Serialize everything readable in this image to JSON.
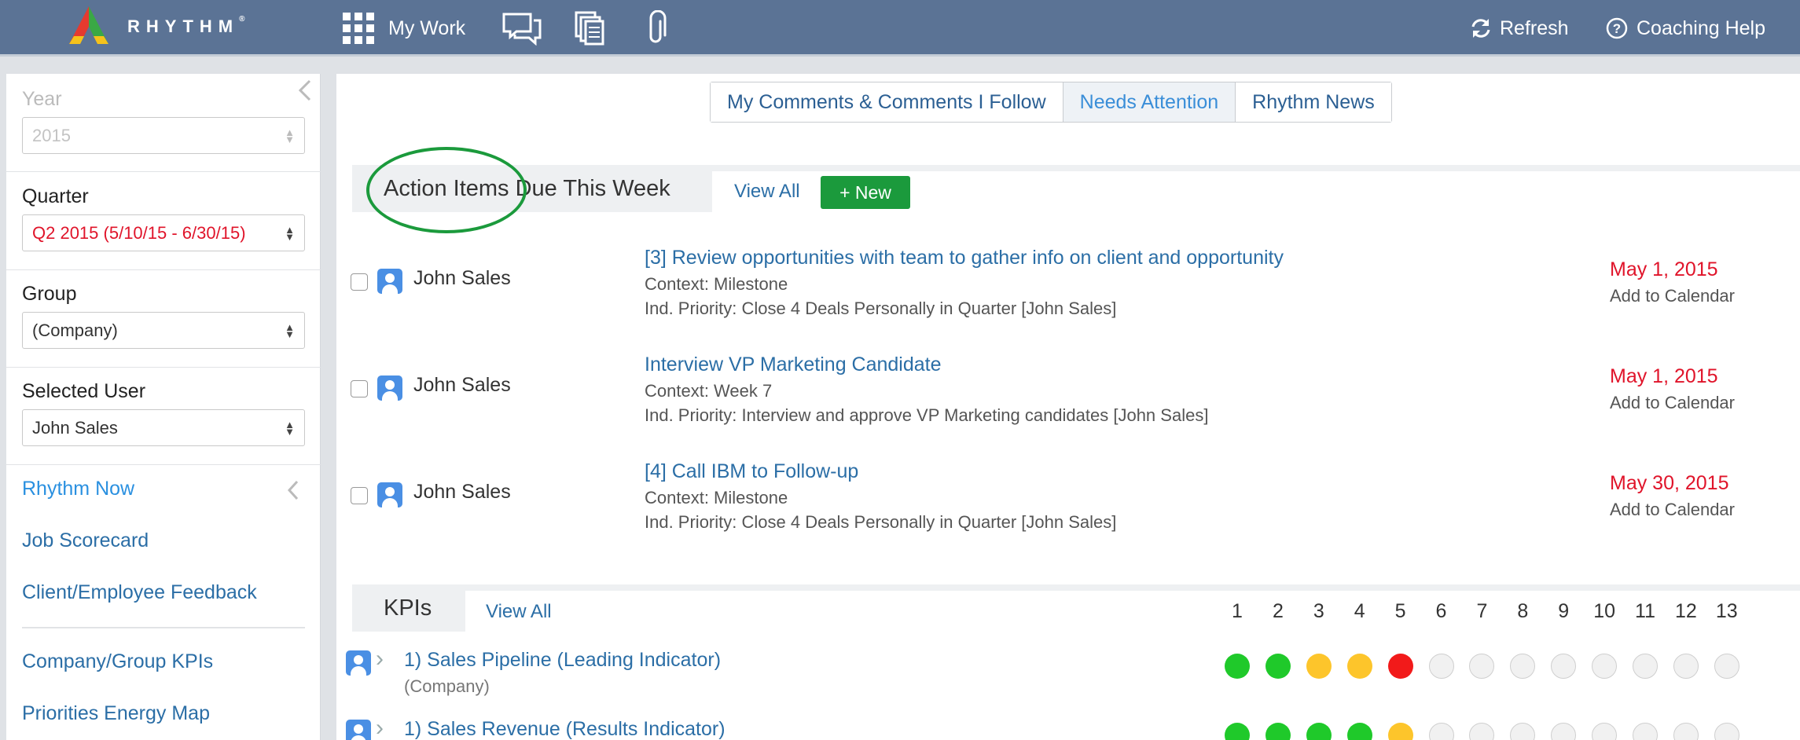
{
  "header": {
    "brand": "RHYTHM",
    "brand_mark": "®",
    "my_work": "My Work",
    "refresh": "Refresh",
    "coaching_help": "Coaching Help"
  },
  "sidebar": {
    "year_label": "Year",
    "year_value": "2015",
    "quarter_label": "Quarter",
    "quarter_value": "Q2 2015 (5/10/15 - 6/30/15)",
    "group_label": "Group",
    "group_value": "(Company)",
    "user_label": "Selected User",
    "user_value": "John Sales",
    "links": [
      "Rhythm Now",
      "Job Scorecard",
      "Client/Employee Feedback",
      "Company/Group KPIs",
      "Priorities Energy Map"
    ]
  },
  "tabs": [
    "My Comments & Comments I Follow",
    "Needs Attention",
    "Rhythm News"
  ],
  "action_items": {
    "title": "Action Items Due This Week",
    "view_all": "View All",
    "new_label": "+ New",
    "items": [
      {
        "owner": "John Sales",
        "title": "[3] Review opportunities with team to gather info on client and opportunity",
        "context": "Context: Milestone",
        "priority": "Ind. Priority: Close 4 Deals Personally in Quarter [John Sales]",
        "date": "May 1, 2015",
        "calendar": "Add to Calendar"
      },
      {
        "owner": "John Sales",
        "title": "Interview VP Marketing Candidate",
        "context": "Context: Week 7",
        "priority": "Ind. Priority: Interview and approve VP Marketing candidates [John Sales]",
        "date": "May 1, 2015",
        "calendar": "Add to Calendar"
      },
      {
        "owner": "John Sales",
        "title": "[4] Call IBM to Follow-up",
        "context": "Context: Milestone",
        "priority": "Ind. Priority: Close 4 Deals Personally in Quarter [John Sales]",
        "date": "May 30, 2015",
        "calendar": "Add to Calendar"
      }
    ]
  },
  "kpis": {
    "title": "KPIs",
    "view_all": "View All",
    "weeks": [
      "1",
      "2",
      "3",
      "4",
      "5",
      "6",
      "7",
      "8",
      "9",
      "10",
      "11",
      "12",
      "13"
    ],
    "rows": [
      {
        "title": "1) Sales Pipeline (Leading Indicator)",
        "sub": "(Company)",
        "statuses": [
          "green",
          "green",
          "yellow",
          "yellow",
          "red",
          "empty",
          "empty",
          "empty",
          "empty",
          "empty",
          "empty",
          "empty",
          "empty"
        ]
      },
      {
        "title": "1) Sales Revenue (Results Indicator)",
        "sub": "",
        "statuses": [
          "green",
          "green",
          "green",
          "green",
          "yellow",
          "empty",
          "empty",
          "empty",
          "empty",
          "empty",
          "empty",
          "empty",
          "empty"
        ]
      }
    ]
  },
  "colors": {
    "header_bg": "#5b7395",
    "link": "#2b6ea6",
    "due_date": "#e0142a",
    "new_button": "#1b9a3c",
    "status_green": "#1fc92a",
    "status_yellow": "#fdc52b",
    "status_red": "#f21a1a"
  },
  "icons": [
    "rhythm-logo-icon",
    "grid-icon",
    "chat-icon",
    "documents-icon",
    "paperclip-icon",
    "refresh-icon",
    "help-icon",
    "collapse-chevron-icon",
    "user-icon",
    "chevron-right-icon"
  ]
}
